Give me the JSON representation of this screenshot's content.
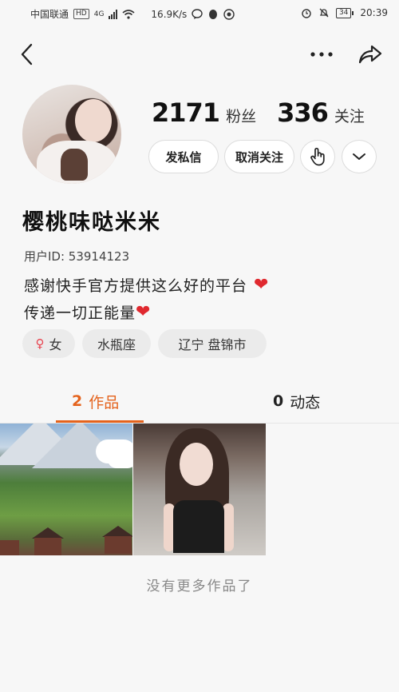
{
  "status_bar": {
    "carrier": "中国联通",
    "network_badge": "HD",
    "network_type": "4G",
    "speed": "16.9K/s",
    "battery": "34",
    "time": "20:39"
  },
  "nav": {
    "back_icon": "back-arrow-icon",
    "more_icon": "more-dots-icon",
    "share_icon": "share-arrow-icon"
  },
  "profile": {
    "followers_count": "2171",
    "followers_label": "粉丝",
    "following_count": "336",
    "following_label": "关注",
    "name": "樱桃味哒米米",
    "user_id": "用户ID: 53914123",
    "bio_line1": "感谢快手官方提供这么好的平台",
    "bio_line2": "传递一切正能量",
    "heart": "❤"
  },
  "actions": {
    "message": "发私信",
    "unfollow": "取消关注"
  },
  "tags": {
    "gender_symbol": "♀",
    "gender": "女",
    "zodiac": "水瓶座",
    "location": "辽宁 盘锦市"
  },
  "tabs": {
    "works_count": "2",
    "works_label": "作品",
    "dynamics_count": "0",
    "dynamics_label": "动态"
  },
  "footer": {
    "no_more": "没有更多作品了"
  },
  "colors": {
    "accent": "#e4631d",
    "heart": "#e0292f"
  }
}
